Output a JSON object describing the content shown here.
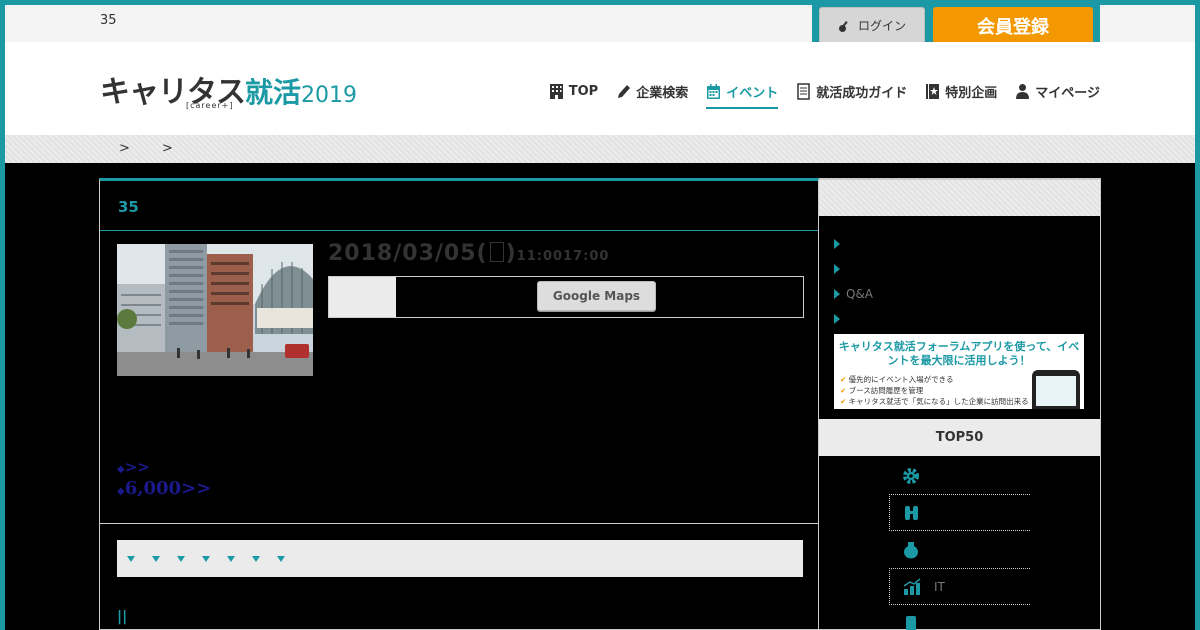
{
  "topbar": {
    "count": "35",
    "login_label": "ログイン",
    "register_label": "会員登録"
  },
  "logo": {
    "kana": "キャリタス",
    "kanji": "就活",
    "year": "2019",
    "sub": "[career+]"
  },
  "nav": [
    {
      "label": "TOP",
      "icon": "building-icon",
      "active": false
    },
    {
      "label": "企業検索",
      "icon": "pencil-icon",
      "active": false
    },
    {
      "label": "イベント",
      "icon": "calendar-icon",
      "active": true
    },
    {
      "label": "就活成功ガイド",
      "icon": "document-icon",
      "active": false
    },
    {
      "label": "特別企画",
      "icon": "star-book-icon",
      "active": false
    },
    {
      "label": "マイページ",
      "icon": "user-icon",
      "active": false
    }
  ],
  "breadcrumb": {
    "text": "> >"
  },
  "event": {
    "title": "35",
    "date": "2018/03/05(",
    "date_end": ")",
    "time": "11:0017:00",
    "map_button": "Google Maps",
    "link1": ">>",
    "link2": "6,000>>",
    "pipe": "||"
  },
  "sidebar": {
    "links": [
      "",
      "",
      "Q&A",
      ""
    ],
    "banner_title": "キャリタス就活フォーラムアプリを使って、イベントを最大限に活用しよう！",
    "banner_bullets": [
      "優先的にイベント入場ができる",
      "ブース訪問履歴を管理",
      "キャリタス就活で「気になる」した企業に訪問出来る"
    ],
    "top50_label": "TOP50",
    "categories": [
      {
        "label": "",
        "icon": "gear-icon"
      },
      {
        "label": "",
        "icon": "figures-icon"
      },
      {
        "label": "",
        "icon": "money-bag-icon"
      },
      {
        "label": "IT",
        "icon": "chart-icon"
      },
      {
        "label": "",
        "icon": "phone-icon"
      }
    ]
  },
  "colors": {
    "accent": "#1b9aa5",
    "register": "#f39800"
  }
}
